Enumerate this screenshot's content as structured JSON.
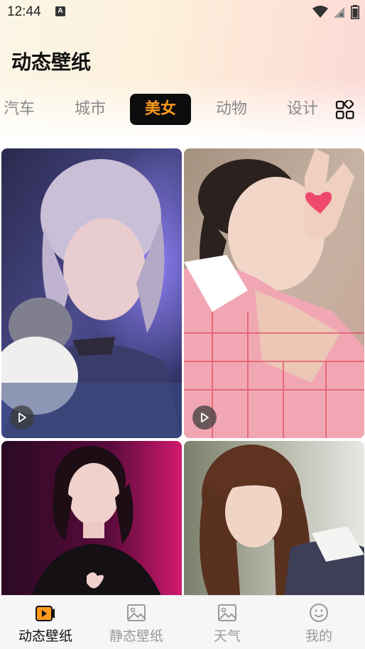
{
  "status_bar": {
    "time": "12:44",
    "notif_letter": "A"
  },
  "page": {
    "title": "动态壁纸"
  },
  "tabs": [
    {
      "label": "汽车"
    },
    {
      "label": "城市"
    },
    {
      "label": "美女",
      "active": true
    },
    {
      "label": "动物"
    },
    {
      "label": "设计"
    }
  ],
  "colors": {
    "accent": "#ff9a1f",
    "tab_active_bg": "#0c0c0c",
    "inactive": "#8a8a8a"
  },
  "wallpapers": [
    {
      "name": "purple-portrait-with-cat",
      "is_video": true
    },
    {
      "name": "pink-plaid-portrait-heart",
      "is_video": true
    },
    {
      "name": "red-light-portrait",
      "is_video": false
    },
    {
      "name": "long-hair-portrait",
      "is_video": false
    }
  ],
  "bottom_nav": [
    {
      "label": "动态壁纸",
      "icon": "video-icon",
      "active": true
    },
    {
      "label": "静态壁纸",
      "icon": "image-icon"
    },
    {
      "label": "天气",
      "icon": "image-icon"
    },
    {
      "label": "我的",
      "icon": "smile-icon"
    }
  ]
}
